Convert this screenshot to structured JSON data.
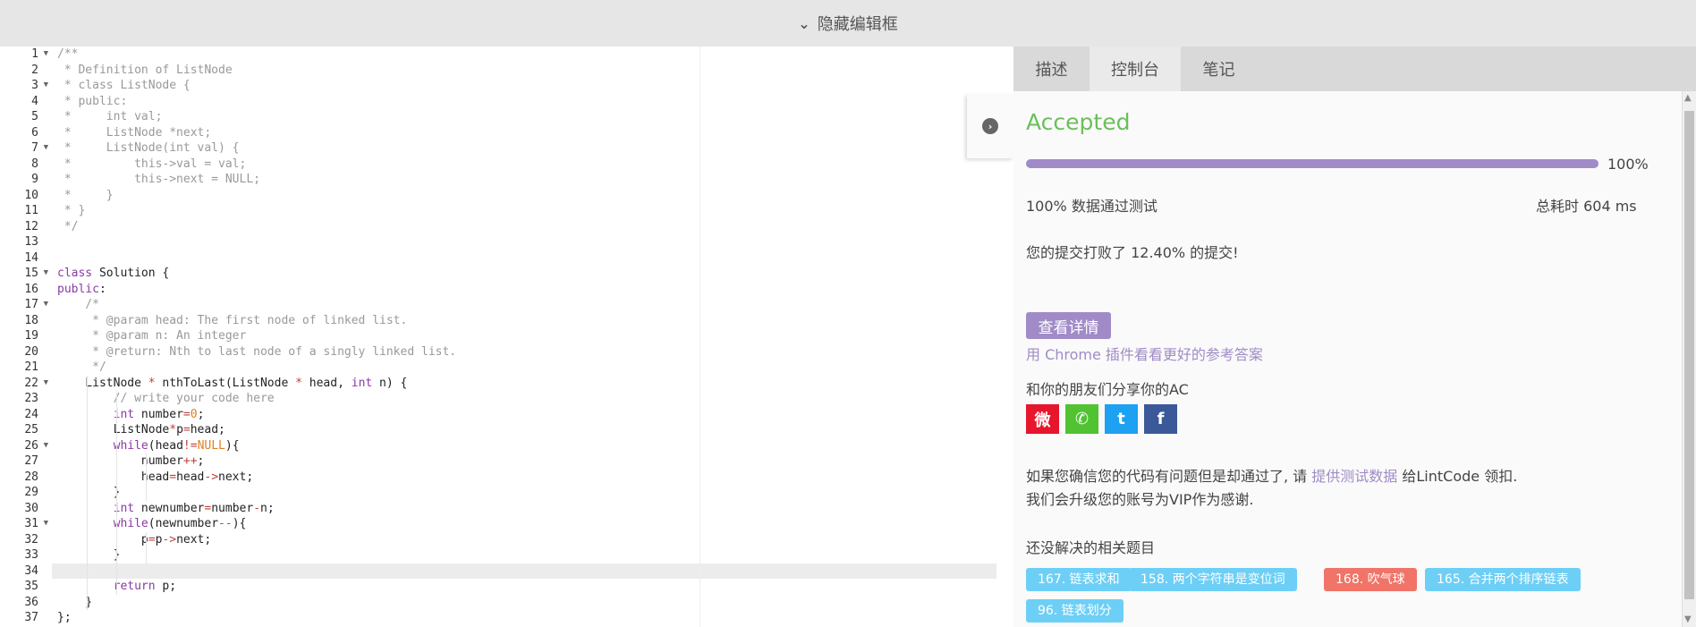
{
  "topbar": {
    "toggle_label": "隐藏编辑框"
  },
  "editor": {
    "highlight_line": 34,
    "lines": [
      {
        "n": 1,
        "fold": true,
        "tokens": [
          [
            "cm",
            "/**"
          ]
        ]
      },
      {
        "n": 2,
        "fold": false,
        "tokens": [
          [
            "cm",
            " * Definition of ListNode"
          ]
        ]
      },
      {
        "n": 3,
        "fold": true,
        "tokens": [
          [
            "cm",
            " * class ListNode {"
          ]
        ]
      },
      {
        "n": 4,
        "fold": false,
        "tokens": [
          [
            "cm",
            " * public:"
          ]
        ]
      },
      {
        "n": 5,
        "fold": false,
        "tokens": [
          [
            "cm",
            " *     int val;"
          ]
        ]
      },
      {
        "n": 6,
        "fold": false,
        "tokens": [
          [
            "cm",
            " *     ListNode *next;"
          ]
        ]
      },
      {
        "n": 7,
        "fold": true,
        "tokens": [
          [
            "cm",
            " *     ListNode(int val) {"
          ]
        ]
      },
      {
        "n": 8,
        "fold": false,
        "tokens": [
          [
            "cm",
            " *         this->val = val;"
          ]
        ]
      },
      {
        "n": 9,
        "fold": false,
        "tokens": [
          [
            "cm",
            " *         this->next = NULL;"
          ]
        ]
      },
      {
        "n": 10,
        "fold": false,
        "tokens": [
          [
            "cm",
            " *     }"
          ]
        ]
      },
      {
        "n": 11,
        "fold": false,
        "tokens": [
          [
            "cm",
            " * }"
          ]
        ]
      },
      {
        "n": 12,
        "fold": false,
        "tokens": [
          [
            "cm",
            " */"
          ]
        ]
      },
      {
        "n": 13,
        "fold": false,
        "tokens": []
      },
      {
        "n": 14,
        "fold": false,
        "tokens": []
      },
      {
        "n": 15,
        "fold": true,
        "tokens": [
          [
            "kw",
            "class"
          ],
          [
            "tx",
            " Solution {"
          ]
        ]
      },
      {
        "n": 16,
        "fold": false,
        "tokens": [
          [
            "kw",
            "public"
          ],
          [
            "tx",
            ":"
          ]
        ]
      },
      {
        "n": 17,
        "fold": true,
        "tokens": [
          [
            "cm",
            "    /*"
          ]
        ]
      },
      {
        "n": 18,
        "fold": false,
        "tokens": [
          [
            "cm",
            "     * @param head: The first node of linked list."
          ]
        ]
      },
      {
        "n": 19,
        "fold": false,
        "tokens": [
          [
            "cm",
            "     * @param n: An integer"
          ]
        ]
      },
      {
        "n": 20,
        "fold": false,
        "tokens": [
          [
            "cm",
            "     * @return: Nth to last node of a singly linked list."
          ]
        ]
      },
      {
        "n": 21,
        "fold": false,
        "tokens": [
          [
            "cm",
            "     */"
          ]
        ]
      },
      {
        "n": 22,
        "fold": true,
        "tokens": [
          [
            "tx",
            "    ListNode "
          ],
          [
            "op",
            "*"
          ],
          [
            "tx",
            " nthToLast(ListNode "
          ],
          [
            "op",
            "*"
          ],
          [
            "tx",
            " head, "
          ],
          [
            "kw",
            "int"
          ],
          [
            "tx",
            " n) {"
          ]
        ]
      },
      {
        "n": 23,
        "fold": false,
        "tokens": [
          [
            "cm",
            "        // write your code here"
          ]
        ]
      },
      {
        "n": 24,
        "fold": false,
        "tokens": [
          [
            "tx",
            "        "
          ],
          [
            "kw",
            "int"
          ],
          [
            "tx",
            " number"
          ],
          [
            "op",
            "="
          ],
          [
            "num",
            "0"
          ],
          [
            "tx",
            ";"
          ]
        ]
      },
      {
        "n": 25,
        "fold": false,
        "tokens": [
          [
            "tx",
            "        ListNode"
          ],
          [
            "op",
            "*"
          ],
          [
            "tx",
            "p"
          ],
          [
            "op",
            "="
          ],
          [
            "tx",
            "head;"
          ]
        ]
      },
      {
        "n": 26,
        "fold": true,
        "tokens": [
          [
            "tx",
            "        "
          ],
          [
            "kw",
            "while"
          ],
          [
            "tx",
            "(head"
          ],
          [
            "op",
            "!="
          ],
          [
            "num",
            "NULL"
          ],
          [
            "tx",
            "){"
          ]
        ]
      },
      {
        "n": 27,
        "fold": false,
        "tokens": [
          [
            "tx",
            "            number"
          ],
          [
            "op",
            "++"
          ],
          [
            "tx",
            ";"
          ]
        ]
      },
      {
        "n": 28,
        "fold": false,
        "tokens": [
          [
            "tx",
            "            head"
          ],
          [
            "op",
            "="
          ],
          [
            "tx",
            "head"
          ],
          [
            "op",
            "->"
          ],
          [
            "tx",
            "next;"
          ]
        ]
      },
      {
        "n": 29,
        "fold": false,
        "tokens": [
          [
            "tx",
            "        }"
          ]
        ]
      },
      {
        "n": 30,
        "fold": false,
        "tokens": [
          [
            "tx",
            "        "
          ],
          [
            "kw",
            "int"
          ],
          [
            "tx",
            " newnumber"
          ],
          [
            "op",
            "="
          ],
          [
            "tx",
            "number"
          ],
          [
            "op",
            "-"
          ],
          [
            "tx",
            "n;"
          ]
        ]
      },
      {
        "n": 31,
        "fold": true,
        "tokens": [
          [
            "tx",
            "        "
          ],
          [
            "kw",
            "while"
          ],
          [
            "tx",
            "(newnumber"
          ],
          [
            "op",
            "--"
          ],
          [
            "tx",
            "){"
          ]
        ]
      },
      {
        "n": 32,
        "fold": false,
        "tokens": [
          [
            "tx",
            "            p"
          ],
          [
            "op",
            "="
          ],
          [
            "tx",
            "p"
          ],
          [
            "op",
            "->"
          ],
          [
            "tx",
            "next;"
          ]
        ]
      },
      {
        "n": 33,
        "fold": false,
        "tokens": [
          [
            "tx",
            "        }"
          ]
        ]
      },
      {
        "n": 34,
        "fold": false,
        "tokens": []
      },
      {
        "n": 35,
        "fold": false,
        "tokens": [
          [
            "tx",
            "        "
          ],
          [
            "kw",
            "return"
          ],
          [
            "tx",
            " p;"
          ]
        ]
      },
      {
        "n": 36,
        "fold": false,
        "tokens": [
          [
            "tx",
            "    }"
          ]
        ]
      },
      {
        "n": 37,
        "fold": false,
        "tokens": [
          [
            "tx",
            "};"
          ]
        ]
      }
    ]
  },
  "tabs": [
    {
      "label": "描述",
      "active": false
    },
    {
      "label": "控制台",
      "active": true
    },
    {
      "label": "笔记",
      "active": false
    }
  ],
  "result": {
    "status": "Accepted",
    "status_color": "#6bbf5b",
    "progress_fraction": 1.0,
    "progress_label": "100%",
    "tests_passed": "100% 数据通过测试",
    "total_time": "总耗时 604 ms",
    "beat_text": "您的提交打败了 12.40% 的提交!",
    "detail_button": "查看详情",
    "chrome_link": "用 Chrome 插件看看更好的参考答案",
    "share_title": "和你的朋友们分享你的AC",
    "share_icons": [
      {
        "name": "weibo-icon",
        "glyph": "微",
        "color": "#e6162d"
      },
      {
        "name": "wechat-icon",
        "glyph": "✆",
        "color": "#51c332"
      },
      {
        "name": "twitter-icon",
        "glyph": "t",
        "color": "#1da1f2"
      },
      {
        "name": "facebook-icon",
        "glyph": "f",
        "color": "#3b5998"
      }
    ],
    "report_prefix": "如果您确信您的代码有问题但是却通过了, 请 ",
    "report_link": "提供测试数据",
    "report_suffix": " 给LintCode 领扣.",
    "report_line2": "我们会升级您的账号为VIP作为感谢.",
    "related_title": "还没解决的相关题目",
    "related": [
      {
        "label": "167. 链表求和",
        "color": "#6dcff6"
      },
      {
        "label": "158. 两个字符串是变位词",
        "color": "#6dcff6"
      },
      {
        "label": "168. 吹气球",
        "color": "#f07468"
      },
      {
        "label": "165. 合并两个排序链表",
        "color": "#6dcff6"
      },
      {
        "label": "96. 链表划分",
        "color": "#6dcff6"
      }
    ]
  },
  "accent_color": "#a08bc7"
}
